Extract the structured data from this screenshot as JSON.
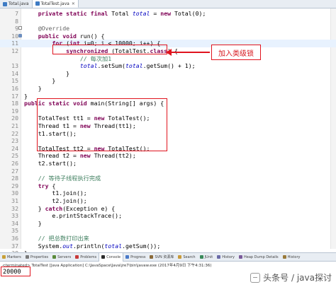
{
  "tabs": [
    {
      "label": "Total.java",
      "active": false
    },
    {
      "label": "TotalTest.java",
      "active": true
    }
  ],
  "callout": {
    "text": "加入类级锁"
  },
  "code_lines": [
    {
      "n": "7",
      "marker": "",
      "hl": false,
      "html": "    <span class=\"kw\">private static final</span> Total <span class=\"fld\">total</span> = <span class=\"kw\">new</span> Total(0);"
    },
    {
      "n": "8",
      "marker": "",
      "hl": false,
      "html": ""
    },
    {
      "n": "9",
      "marker": "minus",
      "hl": false,
      "html": "    <span class=\"ann\">@Override</span>"
    },
    {
      "n": "10",
      "marker": "override",
      "hl": false,
      "html": "    <span class=\"kw\">public void</span> run() {"
    },
    {
      "n": "11",
      "marker": "",
      "hl": true,
      "html": "        <span class=\"kw\">for</span> (<span class=\"kw\">int</span> i=0; i &lt; 10000; i++) {"
    },
    {
      "n": "12",
      "marker": "",
      "hl": false,
      "html": "            <span class=\"kw\">synchronized</span> (TotalTest.<span class=\"kw\">class</span>) {"
    },
    {
      "n": "",
      "marker": "",
      "hl": false,
      "html": "                <span class=\"cmt\">// 每次加1</span>"
    },
    {
      "n": "13",
      "marker": "",
      "hl": false,
      "html": "                <span class=\"fld\">total</span>.setSum(<span class=\"fld\">total</span>.getSum() + 1);"
    },
    {
      "n": "14",
      "marker": "",
      "hl": false,
      "html": "            }"
    },
    {
      "n": "15",
      "marker": "",
      "hl": false,
      "html": "        }"
    },
    {
      "n": "16",
      "marker": "",
      "hl": false,
      "html": "    }"
    },
    {
      "n": "17",
      "marker": "",
      "hl": false,
      "html": "}"
    },
    {
      "n": "18",
      "marker": "",
      "hl": false,
      "html": "<span class=\"kw\">public static void</span> main(String[] args) {"
    },
    {
      "n": "19",
      "marker": "",
      "hl": false,
      "html": ""
    },
    {
      "n": "20",
      "marker": "",
      "hl": false,
      "html": "    TotalTest tt1 = <span class=\"kw\">new</span> TotalTest();"
    },
    {
      "n": "21",
      "marker": "",
      "hl": false,
      "html": "    Thread t1 = <span class=\"kw\">new</span> Thread(tt1);"
    },
    {
      "n": "22",
      "marker": "",
      "hl": false,
      "html": "    t1.start();"
    },
    {
      "n": "23",
      "marker": "",
      "hl": false,
      "html": ""
    },
    {
      "n": "24",
      "marker": "",
      "hl": false,
      "html": "    TotalTest tt2 = <span class=\"kw\">new</span> TotalTest();"
    },
    {
      "n": "25",
      "marker": "",
      "hl": false,
      "html": "    Thread t2 = <span class=\"kw\">new</span> Thread(tt2);"
    },
    {
      "n": "26",
      "marker": "",
      "hl": false,
      "html": "    t2.start();"
    },
    {
      "n": "27",
      "marker": "",
      "hl": false,
      "html": ""
    },
    {
      "n": "28",
      "marker": "",
      "hl": false,
      "html": "    <span class=\"cmt\">// 等待子线程执行完成</span>"
    },
    {
      "n": "29",
      "marker": "",
      "hl": false,
      "html": "    <span class=\"kw\">try</span> {"
    },
    {
      "n": "30",
      "marker": "",
      "hl": false,
      "html": "        t1.join();"
    },
    {
      "n": "31",
      "marker": "",
      "hl": false,
      "html": "        t2.join();"
    },
    {
      "n": "32",
      "marker": "",
      "hl": false,
      "html": "    } <span class=\"kw\">catch</span>(Exception e) {"
    },
    {
      "n": "33",
      "marker": "",
      "hl": false,
      "html": "        e.printStackTrace();"
    },
    {
      "n": "34",
      "marker": "",
      "hl": false,
      "html": "    }"
    },
    {
      "n": "35",
      "marker": "",
      "hl": false,
      "html": ""
    },
    {
      "n": "36",
      "marker": "",
      "hl": false,
      "html": "    <span class=\"cmt\">// 把总数打印出来</span>"
    },
    {
      "n": "37",
      "marker": "",
      "hl": false,
      "html": "    System.<span class=\"fld\">out</span>.println(<span class=\"fld\">total</span>.getSum());"
    },
    {
      "n": "38",
      "marker": "",
      "hl": false,
      "html": "}"
    },
    {
      "n": "39",
      "marker": "",
      "hl": false,
      "html": "}"
    },
    {
      "n": "40",
      "marker": "",
      "hl": false,
      "html": ""
    }
  ],
  "views": [
    {
      "label": "Markers",
      "color": "#c8a038",
      "active": false
    },
    {
      "label": "Properties",
      "color": "#7a7a7a",
      "active": false
    },
    {
      "label": "Servers",
      "color": "#5a8a3a",
      "active": false
    },
    {
      "label": "Problems",
      "color": "#c83a3a",
      "active": false
    },
    {
      "label": "Console",
      "color": "#2a2a2a",
      "active": true
    },
    {
      "label": "Progress",
      "color": "#4a7ac8",
      "active": false
    },
    {
      "label": "SVN 资源库",
      "color": "#8a6a3a",
      "active": false
    },
    {
      "label": "Search",
      "color": "#c89a3a",
      "active": false
    },
    {
      "label": "JUnit",
      "color": "#3a8a5a",
      "active": false
    },
    {
      "label": "History",
      "color": "#6a6aa8",
      "active": false
    },
    {
      "label": "Heap Dump Details",
      "color": "#7a5a9a",
      "active": false
    },
    {
      "label": "History",
      "color": "#9a7a3a",
      "active": false
    }
  ],
  "console": {
    "terminated": "<terminated> TotalTest [Java Application] C:\\JavaSpace\\Java\\jre7\\bin\\javaw.exe (2017年4月9日 下午4:31:36)",
    "output": "20000"
  },
  "watermark": {
    "text": "头条号 / java探讨"
  },
  "colors": {
    "annotation_red": "#e0141e",
    "keyword": "#7f0055",
    "field": "#0000c0",
    "comment": "#3f7f5f"
  }
}
